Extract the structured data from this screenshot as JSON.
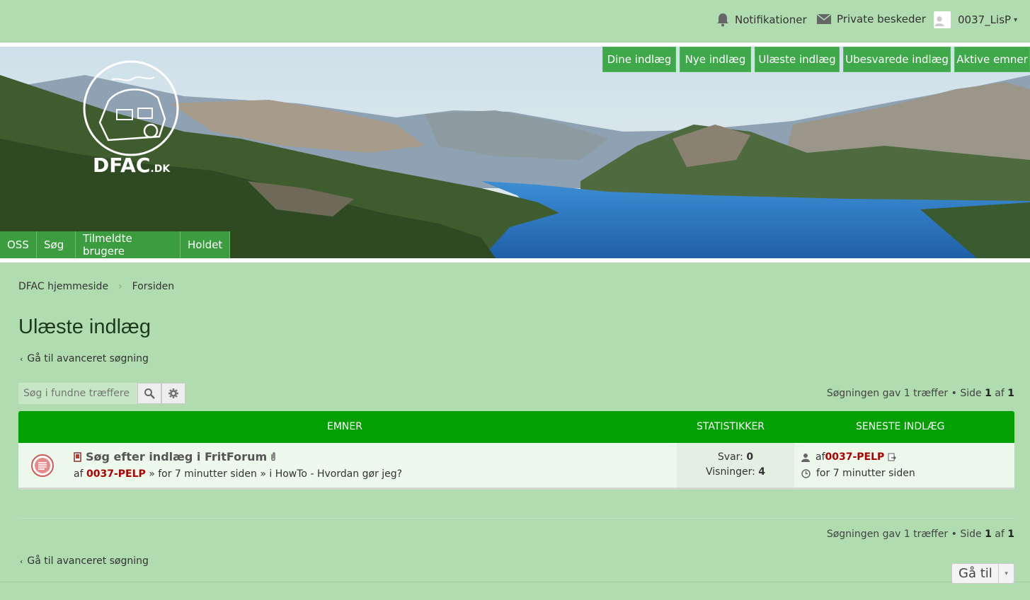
{
  "topbar": {
    "notifications": "Notifikationer",
    "private_messages": "Private beskeder",
    "username": "0037_LisP",
    "caret": "▾"
  },
  "logo": {
    "text": "DFAC",
    "suffix": ".DK"
  },
  "nav_top": [
    "Dine indlæg",
    "Nye indlæg",
    "Ulæste indlæg",
    "Ubesvarede indlæg",
    "Aktive emner"
  ],
  "nav_sub": [
    "OSS",
    "Søg",
    "Tilmeldte brugere",
    "Holdet"
  ],
  "breadcrumb": {
    "home": "DFAC hjemmeside",
    "index": "Forsiden"
  },
  "page": {
    "title": "Ulæste indlæg",
    "advanced_search": "Gå til avanceret søgning"
  },
  "search": {
    "placeholder": "Søg i fundne træffere"
  },
  "results": {
    "prefix": "Søgningen gav 1 træffer • Side ",
    "page": "1",
    "of": " af ",
    "total": "1"
  },
  "table": {
    "headers": {
      "topics": "EMNER",
      "stats": "STATISTIKKER",
      "last": "SENESTE INDLÆG"
    },
    "rows": [
      {
        "title": "Søg efter indlæg i FritForum",
        "by": "af ",
        "author": "0037-PELP",
        "meta": " » for 7 minutter siden » i HowTo - Hvordan gør jeg?",
        "replies_label": "Svar: ",
        "replies": "0",
        "views_label": "Visninger: ",
        "views": "4",
        "last_by": "af ",
        "last_author": "0037-PELP",
        "last_time": "for 7 minutter siden"
      }
    ]
  },
  "jump": {
    "label": "Gå til",
    "caret": "▾"
  },
  "colors": {
    "accent": "#02a002",
    "background": "#b0dcb0",
    "username": "#aa0000"
  }
}
